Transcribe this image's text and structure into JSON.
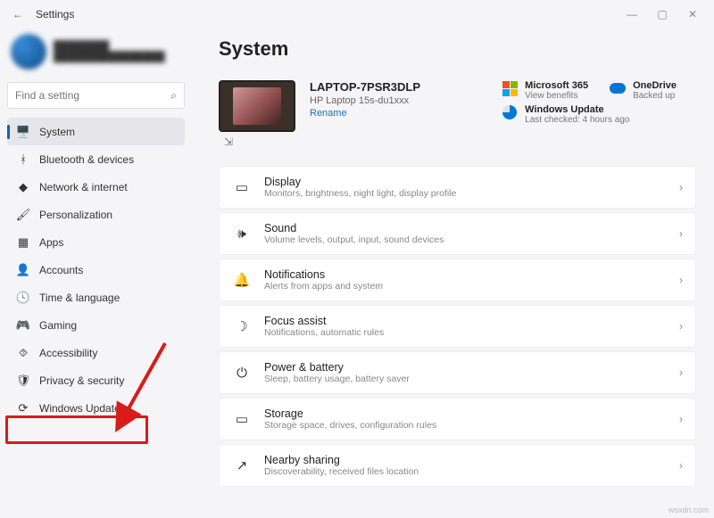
{
  "window": {
    "title": "Settings"
  },
  "user": {
    "name": "████████",
    "email": "████████████████"
  },
  "search": {
    "placeholder": "Find a setting"
  },
  "nav": [
    {
      "key": "system",
      "label": "System",
      "icon": "🖥️",
      "active": true
    },
    {
      "key": "bluetooth",
      "label": "Bluetooth & devices",
      "icon": "ᚼ"
    },
    {
      "key": "network",
      "label": "Network & internet",
      "icon": "◆"
    },
    {
      "key": "personalization",
      "label": "Personalization",
      "icon": "🖌"
    },
    {
      "key": "apps",
      "label": "Apps",
      "icon": "▦"
    },
    {
      "key": "accounts",
      "label": "Accounts",
      "icon": "👤"
    },
    {
      "key": "time",
      "label": "Time & language",
      "icon": "🕓"
    },
    {
      "key": "gaming",
      "label": "Gaming",
      "icon": "🎮"
    },
    {
      "key": "accessibility",
      "label": "Accessibility",
      "icon": "⯑"
    },
    {
      "key": "privacy",
      "label": "Privacy & security",
      "icon": "🛡"
    },
    {
      "key": "update",
      "label": "Windows Update",
      "icon": "⟳"
    }
  ],
  "page": {
    "heading": "System"
  },
  "device": {
    "name": "LAPTOP-7PSR3DLP",
    "model": "HP Laptop 15s-du1xxx",
    "rename": "Rename"
  },
  "status": {
    "ms365": {
      "title": "Microsoft 365",
      "sub": "View benefits"
    },
    "onedrive": {
      "title": "OneDrive",
      "sub": "Backed up"
    },
    "update": {
      "title": "Windows Update",
      "sub": "Last checked: 4 hours ago"
    }
  },
  "cards": [
    {
      "key": "display",
      "icon": "▭",
      "title": "Display",
      "sub": "Monitors, brightness, night light, display profile"
    },
    {
      "key": "sound",
      "icon": "🕪",
      "title": "Sound",
      "sub": "Volume levels, output, input, sound devices"
    },
    {
      "key": "notifications",
      "icon": "🔔",
      "title": "Notifications",
      "sub": "Alerts from apps and system"
    },
    {
      "key": "focus",
      "icon": "☽",
      "title": "Focus assist",
      "sub": "Notifications, automatic rules"
    },
    {
      "key": "power",
      "icon": "⏻",
      "title": "Power & battery",
      "sub": "Sleep, battery usage, battery saver"
    },
    {
      "key": "storage",
      "icon": "▭",
      "title": "Storage",
      "sub": "Storage space, drives, configuration rules"
    },
    {
      "key": "sharing",
      "icon": "↗",
      "title": "Nearby sharing",
      "sub": "Discoverability, received files location"
    }
  ],
  "watermark": "wsxdn.com"
}
